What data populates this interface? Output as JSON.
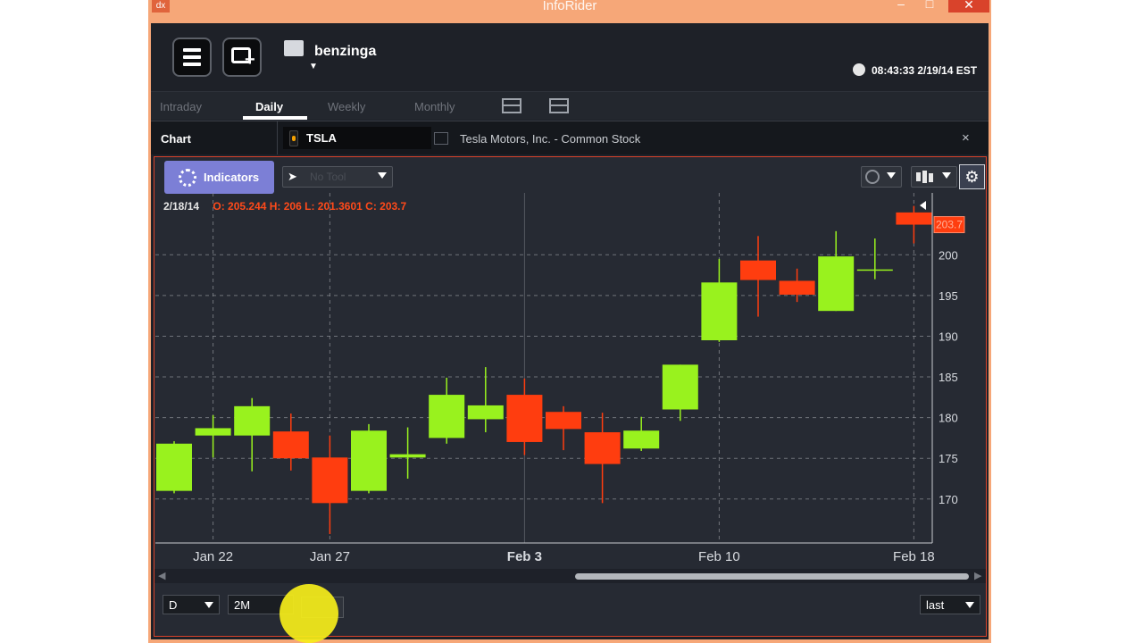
{
  "window": {
    "title": "InfoRider",
    "app_icon_text": "dx",
    "controls": {
      "minimize": "–",
      "maximize": "□",
      "close": "✕"
    }
  },
  "header": {
    "menu_icon": "hamburger-icon",
    "new_window_icon": "new-window-icon",
    "user_icon": "id-card-icon",
    "user_name": "benzinga",
    "user_caret": "▼",
    "clock_icon": "clock-icon",
    "clock": "08:43:33 2/19/14 EST"
  },
  "tabs": [
    {
      "label": "Intraday",
      "active": false
    },
    {
      "label": "Daily",
      "active": true
    },
    {
      "label": "Weekly",
      "active": false
    },
    {
      "label": "Monthly",
      "active": false
    }
  ],
  "chart_bar": {
    "label": "Chart",
    "symbol": "TSLA",
    "company": "Tesla Motors, Inc. - Common Stock",
    "close": "×"
  },
  "toolbar": {
    "indicators_label": "Indicators",
    "tool_placeholder": "No Tool",
    "tool_arrow": "➤",
    "settings_icon": "⚙"
  },
  "info": {
    "date": "2/18/14",
    "ohlc": "O: 205.244 H: 206 L: 201.3601 C: 203.7"
  },
  "chart_data": {
    "type": "candlestick",
    "title": "",
    "last_price_label": "203.7",
    "y_ticks": [
      170,
      175,
      180,
      185,
      190,
      195,
      200
    ],
    "ylim": [
      164.6,
      207.6
    ],
    "x_labels": [
      {
        "label": "Jan 22",
        "index": 1,
        "bold": false
      },
      {
        "label": "Jan 27",
        "index": 4,
        "bold": false
      },
      {
        "label": "Feb 3",
        "index": 9,
        "bold": true
      },
      {
        "label": "Feb 10",
        "index": 14,
        "bold": false
      },
      {
        "label": "Feb 18",
        "index": 19,
        "bold": false
      }
    ],
    "candles": [
      {
        "o": 171.0,
        "h": 177.1,
        "l": 170.7,
        "c": 176.8
      },
      {
        "o": 177.8,
        "h": 180.3,
        "l": 175.1,
        "c": 178.7
      },
      {
        "o": 177.8,
        "h": 182.4,
        "l": 173.4,
        "c": 181.4
      },
      {
        "o": 178.3,
        "h": 180.5,
        "l": 173.5,
        "c": 175.0
      },
      {
        "o": 175.1,
        "h": 177.8,
        "l": 165.7,
        "c": 169.5
      },
      {
        "o": 171.0,
        "h": 179.2,
        "l": 170.7,
        "c": 178.4
      },
      {
        "o": 175.1,
        "h": 178.8,
        "l": 172.5,
        "c": 175.5
      },
      {
        "o": 177.5,
        "h": 184.9,
        "l": 176.8,
        "c": 182.8
      },
      {
        "o": 179.8,
        "h": 186.2,
        "l": 178.2,
        "c": 181.5
      },
      {
        "o": 182.8,
        "h": 184.8,
        "l": 175.4,
        "c": 177.0
      },
      {
        "o": 180.7,
        "h": 181.4,
        "l": 176.0,
        "c": 178.6
      },
      {
        "o": 178.2,
        "h": 180.6,
        "l": 169.5,
        "c": 174.3
      },
      {
        "o": 176.2,
        "h": 180.1,
        "l": 175.9,
        "c": 178.4
      },
      {
        "o": 181.0,
        "h": 186.5,
        "l": 179.6,
        "c": 186.5
      },
      {
        "o": 189.5,
        "h": 199.5,
        "l": 189.3,
        "c": 196.6
      },
      {
        "o": 199.3,
        "h": 202.3,
        "l": 192.4,
        "c": 196.9
      },
      {
        "o": 196.8,
        "h": 198.3,
        "l": 194.2,
        "c": 195.1
      },
      {
        "o": 193.1,
        "h": 202.9,
        "l": 193.1,
        "c": 199.8
      },
      {
        "o": 198.2,
        "h": 202.0,
        "l": 197.0,
        "c": 198.2
      },
      {
        "o": 205.2,
        "h": 206.0,
        "l": 201.4,
        "c": 203.7
      }
    ],
    "colors": {
      "up": "#99f21e",
      "down": "#ff3d0f",
      "grid": "#8e9298",
      "bg": "#262a33"
    }
  },
  "bottom": {
    "period": "D",
    "range": "2M",
    "price_type": "last"
  }
}
